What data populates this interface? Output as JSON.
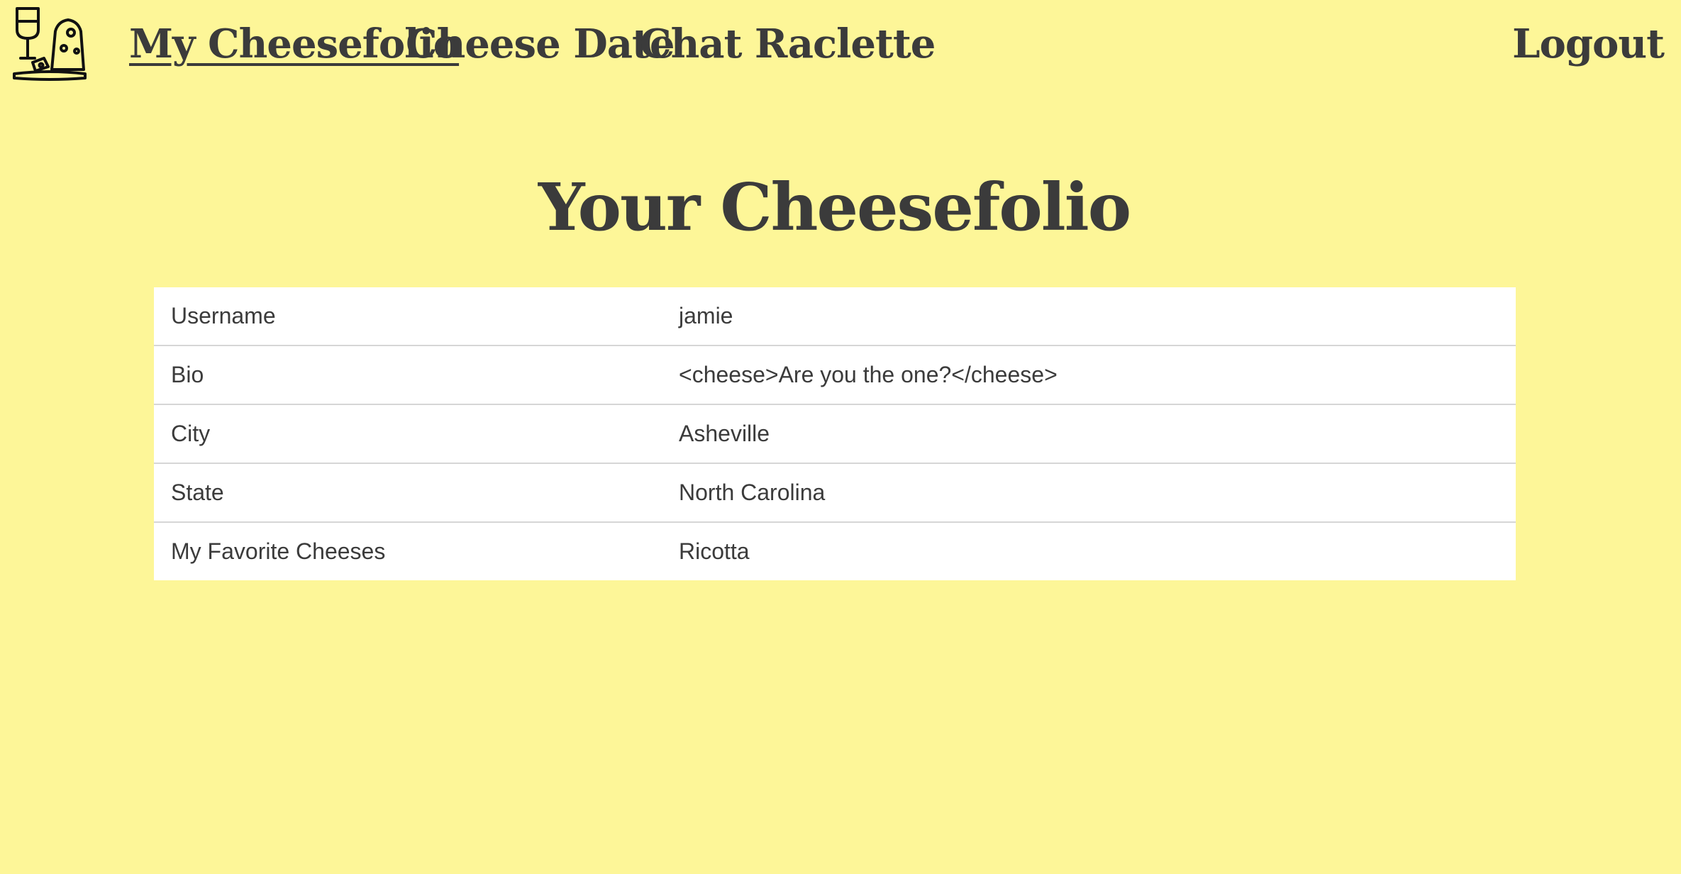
{
  "nav": {
    "logo_icon": "wine-and-cheese-board-icon",
    "links": [
      {
        "label": "My Cheesefolio",
        "active": true
      },
      {
        "label": "Cheese Date",
        "active": false
      },
      {
        "label": "Chat Raclette",
        "active": false
      }
    ],
    "logout_label": "Logout"
  },
  "main": {
    "title": "Your Cheesefolio",
    "profile": [
      {
        "label": "Username",
        "value": "jamie"
      },
      {
        "label": "Bio",
        "value": "<cheese>Are you the one?</cheese>"
      },
      {
        "label": "City",
        "value": "Asheville"
      },
      {
        "label": "State",
        "value": "North Carolina"
      },
      {
        "label": "My Favorite Cheeses",
        "value": "Ricotta"
      }
    ]
  },
  "colors": {
    "background": "#fdf698",
    "text": "#3b3b3b",
    "table_background": "#ffffff",
    "row_divider": "#d6d6d6"
  }
}
